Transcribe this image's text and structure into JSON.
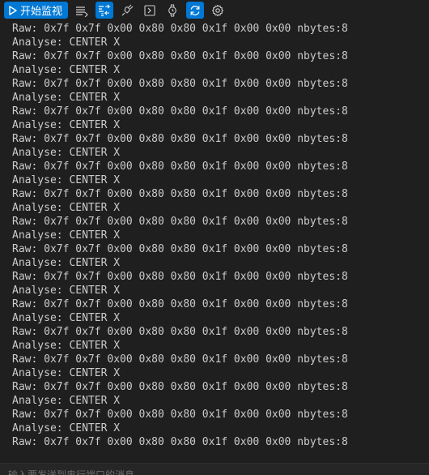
{
  "toolbar": {
    "start_label": "开始监视",
    "icons": [
      "list-icon",
      "code-swap-icon",
      "plug-icon",
      "terminal-icon",
      "watch-icon",
      "refresh-icon",
      "gear-icon"
    ]
  },
  "output": {
    "lines": [
      "Raw: 0x7f 0x7f 0x00 0x80 0x80 0x1f 0x00 0x00 nbytes:8",
      "Analyse: CENTER X",
      "Raw: 0x7f 0x7f 0x00 0x80 0x80 0x1f 0x00 0x00 nbytes:8",
      "Analyse: CENTER X",
      "Raw: 0x7f 0x7f 0x00 0x80 0x80 0x1f 0x00 0x00 nbytes:8",
      "Analyse: CENTER X",
      "Raw: 0x7f 0x7f 0x00 0x80 0x80 0x1f 0x00 0x00 nbytes:8",
      "Analyse: CENTER X",
      "Raw: 0x7f 0x7f 0x00 0x80 0x80 0x1f 0x00 0x00 nbytes:8",
      "Analyse: CENTER X",
      "Raw: 0x7f 0x7f 0x00 0x80 0x80 0x1f 0x00 0x00 nbytes:8",
      "Analyse: CENTER X",
      "Raw: 0x7f 0x7f 0x00 0x80 0x80 0x1f 0x00 0x00 nbytes:8",
      "Analyse: CENTER X",
      "Raw: 0x7f 0x7f 0x00 0x80 0x80 0x1f 0x00 0x00 nbytes:8",
      "Analyse: CENTER X",
      "Raw: 0x7f 0x7f 0x00 0x80 0x80 0x1f 0x00 0x00 nbytes:8",
      "Analyse: CENTER X",
      "Raw: 0x7f 0x7f 0x00 0x80 0x80 0x1f 0x00 0x00 nbytes:8",
      "Analyse: CENTER X",
      "Raw: 0x7f 0x7f 0x00 0x80 0x80 0x1f 0x00 0x00 nbytes:8",
      "Analyse: CENTER X",
      "Raw: 0x7f 0x7f 0x00 0x80 0x80 0x1f 0x00 0x00 nbytes:8",
      "Analyse: CENTER X",
      "Raw: 0x7f 0x7f 0x00 0x80 0x80 0x1f 0x00 0x00 nbytes:8",
      "Analyse: CENTER X",
      "Raw: 0x7f 0x7f 0x00 0x80 0x80 0x1f 0x00 0x00 nbytes:8",
      "Analyse: CENTER X",
      "Raw: 0x7f 0x7f 0x00 0x80 0x80 0x1f 0x00 0x00 nbytes:8",
      "Analyse: CENTER X",
      "Raw: 0x7f 0x7f 0x00 0x80 0x80 0x1f 0x00 0x00 nbytes:8"
    ]
  },
  "input": {
    "placeholder": "输入要发送到串行端口的消息"
  },
  "colors": {
    "background": "#1f1f1f",
    "accent": "#0078d4",
    "text": "#cccccc"
  }
}
